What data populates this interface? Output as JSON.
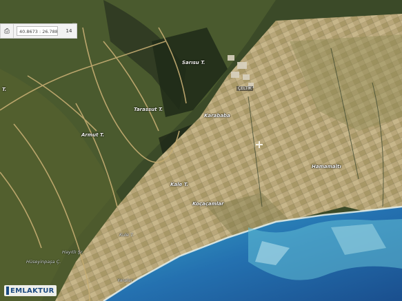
{
  "toolbar": {
    "print_icon": "printer-icon",
    "coordinates": "40.8673 : 26.7883",
    "zoom_level": "14"
  },
  "top_cut_label": "...",
  "village_label": "ÇELTİK",
  "labels": {
    "sarisu": "Sarısu T.",
    "tarassut": "Tarassut T.",
    "karababa": "Karababa",
    "armut": "Armut T.",
    "hamamalti": "Hamamaltı",
    "kale": "Kale T.",
    "kocacamlar": "Koçaçamlar",
    "kule": "Kule T.",
    "hayitli": "Hayıtlı Şr.",
    "huseyinpasa": "Hüseyinpaşa Ç.",
    "yaralar": "Yaralar",
    "left_t": "T."
  },
  "logo": {
    "text": "EMLAKTUR"
  },
  "colors": {
    "sea_deep": "#1f5fa0",
    "sea_shallow": "#6cc4d8",
    "farmland": "#b8a878",
    "forest": "#3c4a26"
  }
}
